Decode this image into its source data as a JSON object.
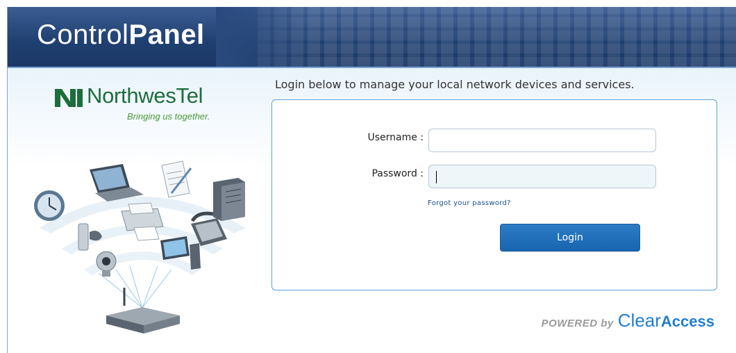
{
  "header": {
    "title_light": "Control",
    "title_bold": "Panel"
  },
  "logo": {
    "name": "NorthwesTel",
    "tagline": "Bringing us together.",
    "brand_color": "#1d6e3c"
  },
  "login": {
    "intro": "Login below to manage your local network devices and services.",
    "username_label": "Username :",
    "username_value": "",
    "password_label": "Password :",
    "password_value": "",
    "forgot_link": "Forgot your password?",
    "login_button": "Login"
  },
  "footer": {
    "powered_by": "POWERED by",
    "brand_clear": "Clear",
    "brand_access": "Access"
  },
  "colors": {
    "header": "#1f3f70",
    "accent": "#1f7fd0",
    "button": "#1965b0"
  },
  "illustration_icons": [
    "clock-icon",
    "laptop-icon",
    "document-icon",
    "server-icon",
    "printer-icon",
    "game-controller-icon",
    "phone-icon",
    "webcam-icon",
    "monitor-icon",
    "router-icon"
  ]
}
